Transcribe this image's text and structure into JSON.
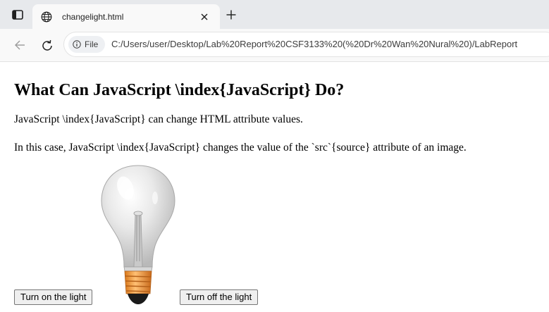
{
  "browser": {
    "tab": {
      "title": "changelight.html",
      "favicon": "globe-icon",
      "close_icon": "close-icon"
    },
    "new_tab_icon": "plus-icon",
    "address_bar": {
      "security_chip_label": "File",
      "url": "C:/Users/user/Desktop/Lab%20Report%20CSF3133%20(%20Dr%20Wan%20Nural%20)/LabReport"
    }
  },
  "page": {
    "heading": "What Can JavaScript \\index{JavaScript} Do?",
    "paragraphs": [
      "JavaScript \\index{JavaScript} can change HTML attribute values.",
      "In this case, JavaScript \\index{JavaScript} changes the value of the `src`{source} attribute of an image."
    ],
    "image": {
      "subject": "light bulb (off)"
    },
    "buttons": {
      "turn_on": "Turn on the light",
      "turn_off": "Turn off the light"
    }
  },
  "colors": {
    "tabstrip_bg": "#e7e9ec",
    "active_tab_bg": "#f9f9f9",
    "button_bg": "#efefef",
    "bulb_base": "#f39a2b"
  }
}
